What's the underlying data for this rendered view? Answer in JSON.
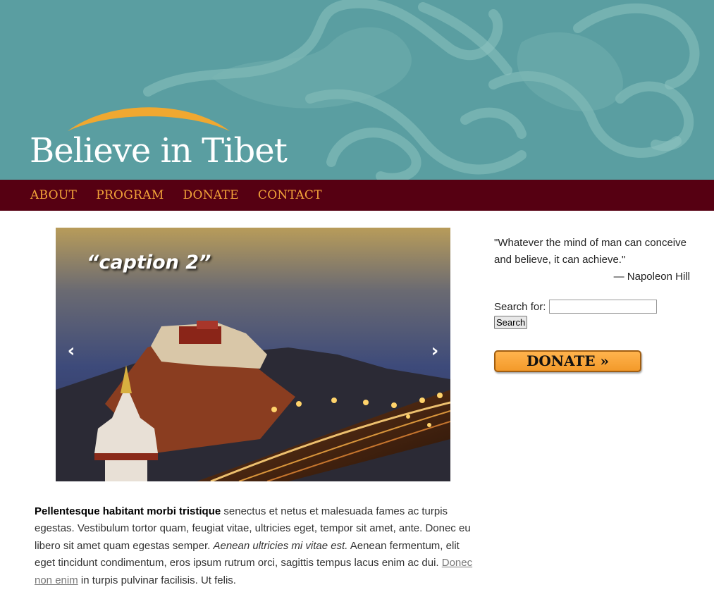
{
  "header": {
    "logo_text": "Believe in Tibet"
  },
  "nav": {
    "items": [
      "ABOUT",
      "PROGRAM",
      "DONATE",
      "CONTACT"
    ]
  },
  "slider": {
    "caption": "“caption 2”",
    "prev_label": "‹",
    "next_label": "›"
  },
  "content": {
    "bold_lead": "Pellentesque habitant morbi tristique",
    "text1": " senectus et netus et malesuada fames ac turpis egestas. Vestibulum tortor quam, feugiat vitae, ultricies eget, tempor sit amet, ante. Donec eu libero sit amet quam egestas semper. ",
    "italic": "Aenean ultricies mi vitae est.",
    "text2": " Aenean fermentum, elit eget tincidunt condimentum, eros ipsum rutrum orci, sagittis tempus lacus enim ac dui. ",
    "link": "Donec non enim",
    "text3": " in turpis pulvinar facilisis. Ut felis."
  },
  "sidebar": {
    "quote": "\"Whatever the mind of man can conceive and believe, it can achieve.\"",
    "quote_author": "— Napoleon Hill",
    "search_label": "Search for:",
    "search_value": "",
    "search_button": "Search",
    "donate_button": "DONATE »"
  },
  "colors": {
    "header_bg": "#5a9ea1",
    "nav_bg": "#560012",
    "nav_text": "#f3a43a",
    "logo_arc": "#f0a830",
    "donate_bg": "#f7a23a"
  }
}
